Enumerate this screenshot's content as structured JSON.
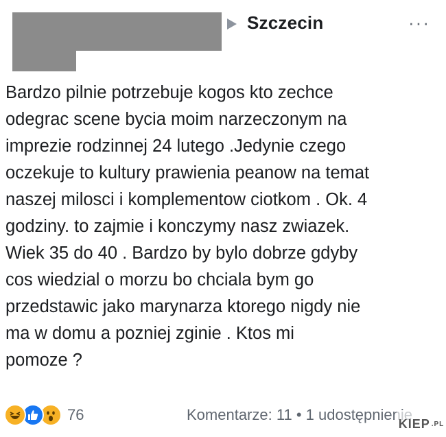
{
  "header": {
    "group_name": "Szczecin",
    "menu_label": "···"
  },
  "post": {
    "lines": [
      "Bardzo pilnie potrzebuje kogos kto zechce",
      "odegrac scene bycia moim narzeczonym na",
      "imprezie rodzinnej 24 lutego .Jedynie czego",
      "oczekuje to kultury prawienia peanow na temat",
      "naszej milosci i komplementow ciotkom . Ok. 4",
      "godziny. to zajmie i konczymy nasz zwiazek.",
      "Wiek 35 do 40 . Bardzo by bylo dobrze gdyby",
      "cos wiedzial o morzu bo chciala bym go",
      "przedstawic jako marynarza ktorego nigdy nie",
      "ma w domu a pozniej zginie . Ktos mi",
      "pomoze ?"
    ]
  },
  "reactions": {
    "icons": [
      "haha-icon",
      "like-icon",
      "wow-icon"
    ],
    "count": "76"
  },
  "footer": {
    "comments": "Komentarze: 11",
    "separator": "•",
    "shares": "1 udostępnienie"
  },
  "watermark": {
    "text": "KIEP",
    "suffix": ".PL"
  },
  "colors": {
    "redaction": "#8b8b8b",
    "text": "#1c1e21",
    "secondary": "#606770",
    "like": "#1877f2",
    "haha": "#f7b125"
  }
}
